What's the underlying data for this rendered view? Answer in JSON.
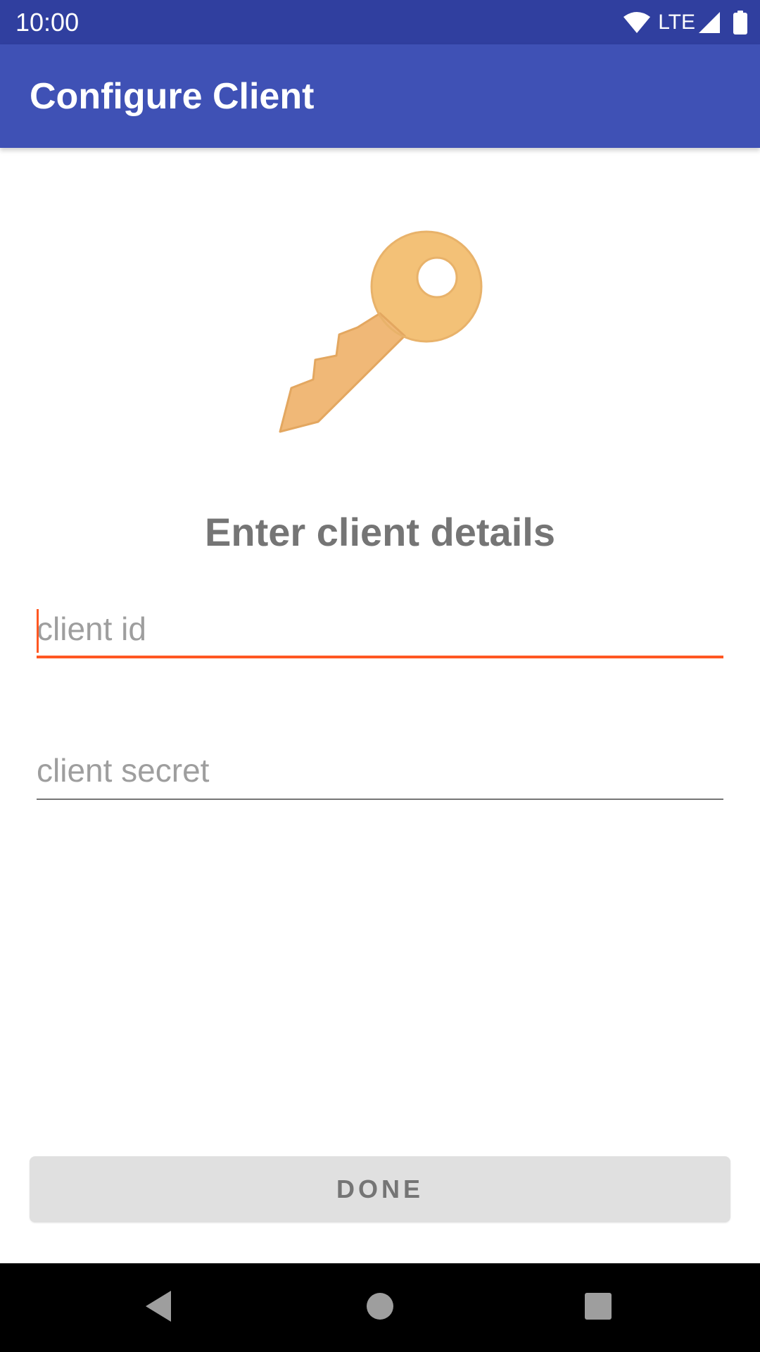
{
  "status_bar": {
    "time": "10:00",
    "network": "LTE",
    "color": "#303F9F"
  },
  "app_bar": {
    "title": "Configure Client",
    "color": "#3F51B5"
  },
  "icons": {
    "hero": "key-icon",
    "wifi": "wifi-icon",
    "signal": "signal-icon",
    "battery": "battery-icon",
    "back": "back-icon",
    "home": "home-icon",
    "recents": "recents-icon"
  },
  "form": {
    "heading": "Enter client details",
    "client_id": {
      "value": "",
      "placeholder": "client id",
      "focused": true
    },
    "client_secret": {
      "value": "",
      "placeholder": "client secret",
      "focused": false
    },
    "accent_color": "#FF5722"
  },
  "done_button": {
    "label": "DONE",
    "enabled": false
  }
}
